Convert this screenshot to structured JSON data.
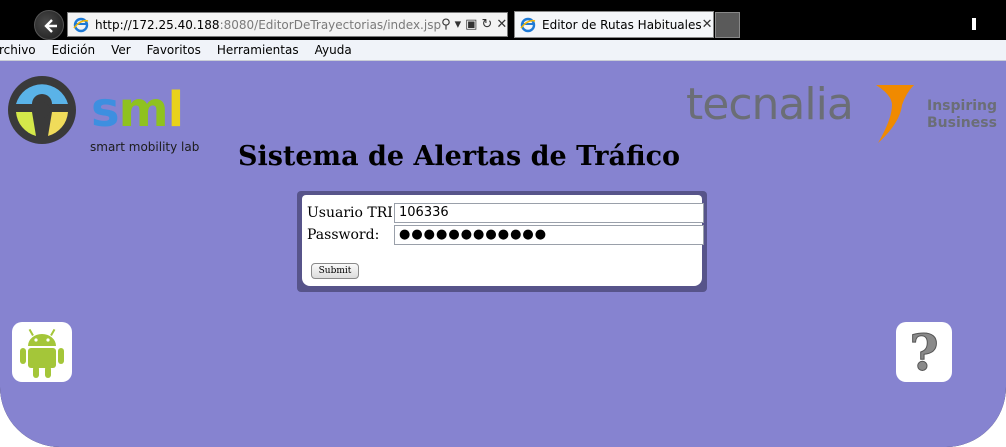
{
  "browser": {
    "url_host": "http://172.25.40.188",
    "url_rest": ":8080/EditorDeTrayectorias/index.jsp",
    "tab_title": "Editor de Rutas Habituales",
    "icons": [
      "back-icon",
      "ie-icon",
      "search-icon",
      "compat-icon",
      "refresh-icon",
      "stop-icon",
      "close-icon"
    ]
  },
  "menu": [
    "rchivo",
    "Edición",
    "Ver",
    "Favoritos",
    "Herramientas",
    "Ayuda"
  ],
  "logos": {
    "sml_text": "sml",
    "sml_sub": "smart mobility lab",
    "tecnalia_word": "tecnalia",
    "tecnalia_tag1": "Inspiring",
    "tecnalia_tag2": "Business"
  },
  "page": {
    "title": "Sistema de Alertas de Tráfico"
  },
  "login": {
    "user_label": "Usuario TRI:",
    "user_value": "106336",
    "password_label": "Password:",
    "password_value": "●●●●●●●●●●●●",
    "submit_label": "Submit"
  },
  "colors": {
    "page_bg": "#8683d0",
    "frame": "#57548a",
    "sml_blue": "#3d8fe0",
    "sml_green": "#8fc21f",
    "sml_yellow": "#e9d21a",
    "tecnalia_grey": "#6b6e76",
    "tecnalia_orange": "#f08a00",
    "android_green": "#a4c639"
  }
}
